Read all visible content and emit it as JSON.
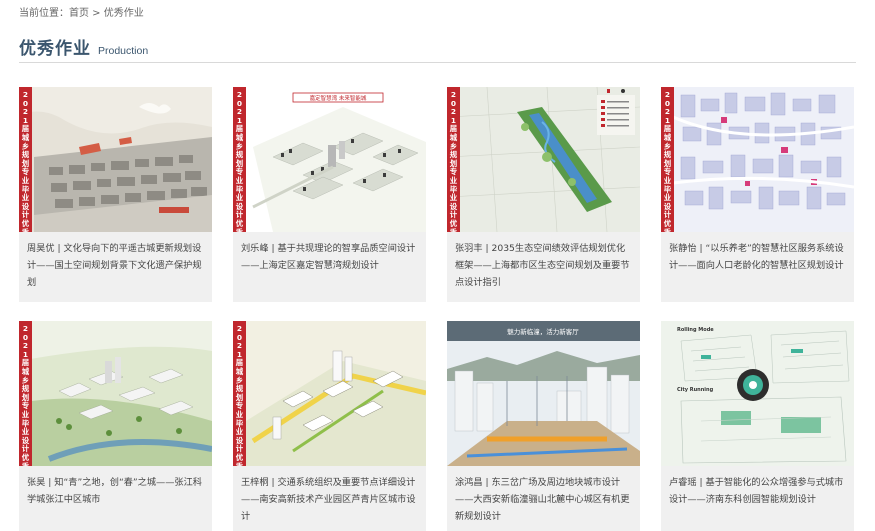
{
  "breadcrumb": {
    "prefix": "当前位置：",
    "home": "首页",
    "separator": " > ",
    "current": "优秀作业"
  },
  "section": {
    "title": "优秀作业",
    "subtitle": "Production"
  },
  "badge_text": "2021届城乡规划专业毕业设计优秀作品",
  "cards": [
    {
      "caption": "周昊优 | 文化导向下的平遥古城更新规划设计——国土空间规划背景下文化遗产保护规划"
    },
    {
      "caption": "刘乐峰 | 基于共现理论的智享品质空间设计——上海定区嘉定智慧湾规划设计",
      "banner": "嘉定智慧湾 未来智能城"
    },
    {
      "caption": "张羽丰 | 2035生态空间绩效评估规划优化框架——上海都市区生态空间规划及重要节点设计指引"
    },
    {
      "caption": "张静怡 | “以乐养老”的智慧社区服务系统设计——面向人口老龄化的智慧社区规划设计"
    },
    {
      "caption": "张昊 | 知“青”之地，创“春”之城——张江科学城张江中区城市"
    },
    {
      "caption": "王梓桐 | 交通系统组织及重要节点详细设计——南安高新技术产业园区芦青片区城市设计"
    },
    {
      "caption": "涂鸿昌 | 东三岔广场及周边地块城市设计——大西安新临潼骊山北麓中心城区有机更新规划设计",
      "banner": "魅力新临潼，活力新客厅"
    },
    {
      "caption": "卢睿瑶 | 基于智能化的公众增强参与式城市设计——济南东科创园智能规划设计",
      "label_top": "Rolling Mode",
      "label_mid": "City Running"
    }
  ]
}
